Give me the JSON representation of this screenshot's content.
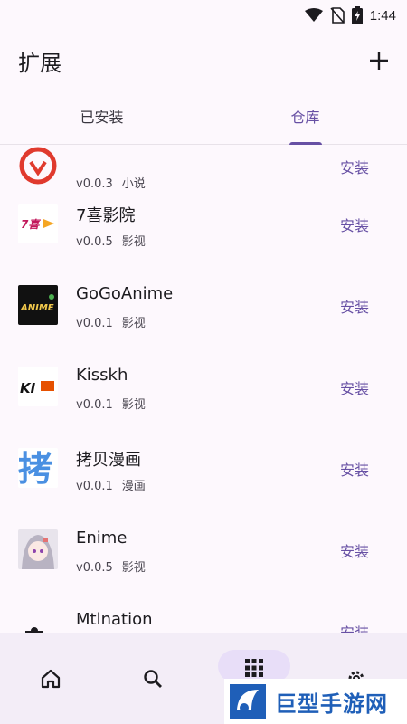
{
  "status": {
    "time": "1:44"
  },
  "app_bar": {
    "title": "扩展"
  },
  "tabs": [
    {
      "label": "已安装"
    },
    {
      "label": "仓库"
    }
  ],
  "install_label": "安装",
  "extensions": [
    {
      "name": "",
      "version": "v0.0.3",
      "category": "小说",
      "icon": "red-circle-logo-icon"
    },
    {
      "name": "7喜影院",
      "version": "v0.0.5",
      "category": "影视",
      "icon": "7xi-logo-icon"
    },
    {
      "name": "GoGoAnime",
      "version": "v0.0.1",
      "category": "影视",
      "icon": "gogoanime-logo-icon"
    },
    {
      "name": "Kisskh",
      "version": "v0.0.1",
      "category": "影视",
      "icon": "kisskh-logo-icon"
    },
    {
      "name": "拷贝漫画",
      "version": "v0.0.1",
      "category": "漫画",
      "icon": "copymanga-logo-icon"
    },
    {
      "name": "Enime",
      "version": "v0.0.5",
      "category": "影视",
      "icon": "enime-avatar-icon"
    },
    {
      "name": "Mtlnation",
      "version": "",
      "category": "",
      "icon": "puzzle-icon"
    }
  ],
  "bottom_nav": [
    {
      "icon": "home-icon"
    },
    {
      "icon": "search-icon"
    },
    {
      "icon": "grid-icon",
      "selected": true
    },
    {
      "icon": "settings-icon"
    }
  ],
  "watermark": {
    "text": "巨型手游网"
  },
  "colors": {
    "accent": "#6750a4",
    "background": "#fdf8fd",
    "nav_background": "#f3edf7",
    "pill": "#e8def8"
  }
}
